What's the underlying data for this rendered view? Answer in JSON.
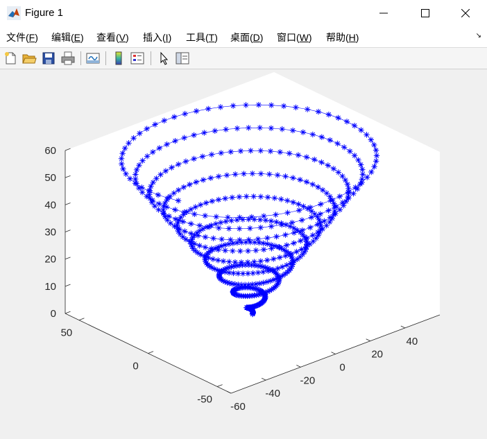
{
  "window": {
    "title": "Figure 1",
    "controls": {
      "minimize": "—",
      "maximize": "☐",
      "close": "✕"
    }
  },
  "menu": {
    "items": [
      {
        "label": "文件(",
        "key": "F",
        "suffix": ")"
      },
      {
        "label": "编辑(",
        "key": "E",
        "suffix": ")"
      },
      {
        "label": "查看(",
        "key": "V",
        "suffix": ")"
      },
      {
        "label": "插入(",
        "key": "I",
        "suffix": ")"
      },
      {
        "label": "工具(",
        "key": "T",
        "suffix": ")"
      },
      {
        "label": "桌面(",
        "key": "D",
        "suffix": ")"
      },
      {
        "label": "窗口(",
        "key": "W",
        "suffix": ")"
      },
      {
        "label": "帮助(",
        "key": "H",
        "suffix": ")"
      }
    ],
    "overflow_icon": "↘"
  },
  "toolbar": {
    "buttons": [
      "new-figure-icon",
      "open-file-icon",
      "save-icon",
      "print-icon",
      "link-plot-icon",
      "insert-colorbar-icon",
      "insert-legend-icon",
      "edit-plot-pointer-icon",
      "property-inspector-icon"
    ]
  },
  "colors": {
    "series": "#0000ff",
    "axes_bg": "#ffffff",
    "figure_bg": "#f0f0f0",
    "axis": "#262626"
  },
  "chart_data": {
    "type": "line3d",
    "title": "",
    "xlabel": "",
    "ylabel": "",
    "zlabel": "",
    "marker": "*",
    "xlim": [
      -60,
      60
    ],
    "ylim": [
      -60,
      60
    ],
    "zlim": [
      0,
      60
    ],
    "xticks": [
      -60,
      -40,
      -20,
      0,
      20,
      40
    ],
    "yticks": [
      -50,
      0,
      50
    ],
    "zticks": [
      0,
      10,
      20,
      30,
      40,
      50,
      60
    ],
    "grid": false,
    "series": [
      {
        "function": {
          "x": "t*cos(t)",
          "y": "t*sin(t)",
          "z": "t"
        },
        "t_range": [
          0,
          60
        ],
        "point_count": 601
      }
    ]
  }
}
